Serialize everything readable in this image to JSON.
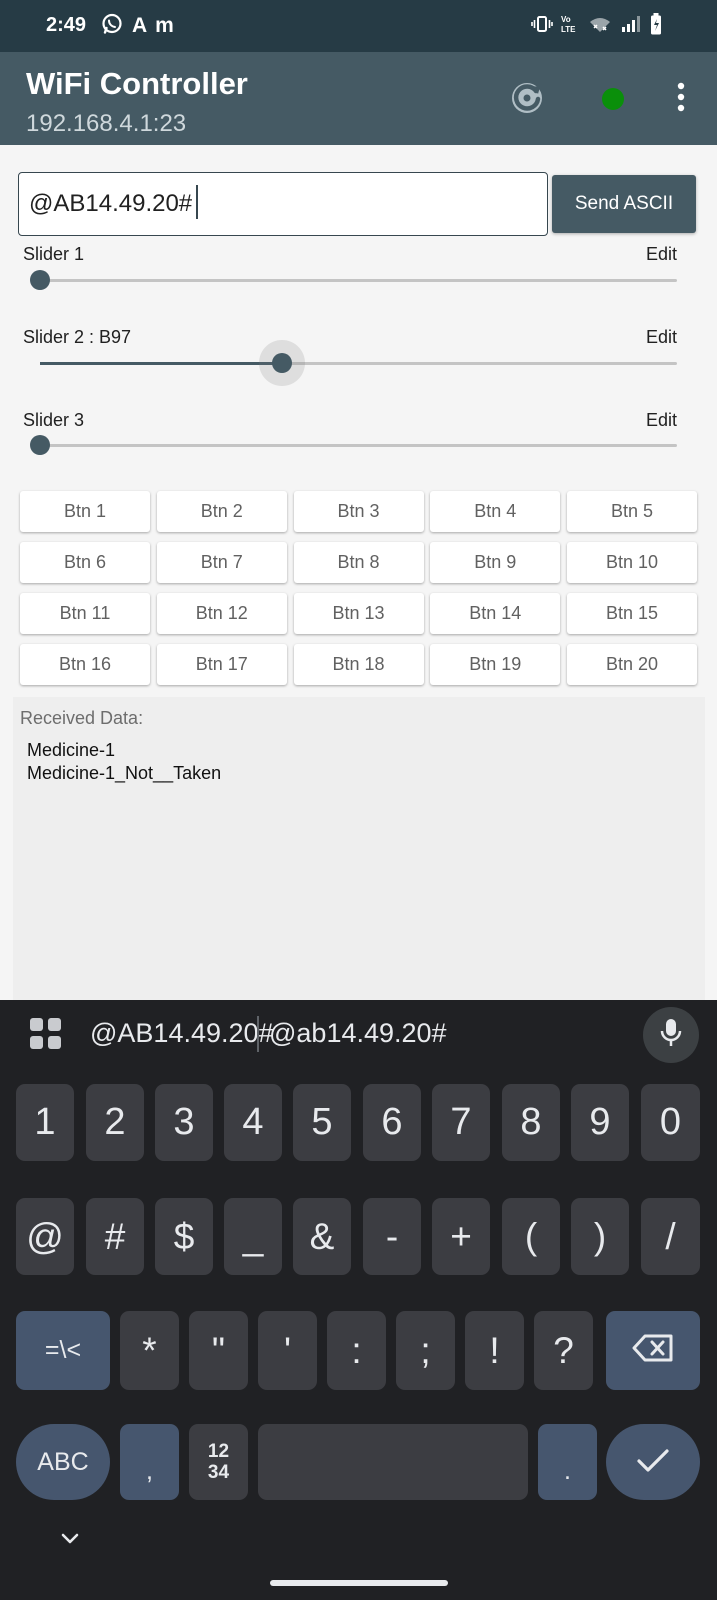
{
  "status_bar": {
    "time": "2:49",
    "left_icons": [
      "whatsapp-icon",
      "a-icon",
      "m-icon"
    ],
    "letter_a": "A",
    "letter_m": "m",
    "right_icons": [
      "vibrate-icon",
      "volte-icon",
      "wifi-data-icon",
      "signal-icon",
      "battery-icon"
    ],
    "volte_label": "VoLTE"
  },
  "app_bar": {
    "title": "WiFi Controller",
    "subtitle": "192.168.4.1:23",
    "actions": [
      "refresh-icon",
      "connection-status-dot",
      "more-vert-icon"
    ],
    "status_color": "#0a8f0a",
    "background": "#455a64"
  },
  "ascii_input": {
    "value": "@AB14.49.20#"
  },
  "send_button": {
    "label": "Send ASCII"
  },
  "sliders": [
    {
      "label": "Slider 1",
      "edit": "Edit",
      "value_fraction": 0.0
    },
    {
      "label": "Slider 2 : B97",
      "edit": "Edit",
      "value_fraction": 0.38
    },
    {
      "label": "Slider 3",
      "edit": "Edit",
      "value_fraction": 0.0
    }
  ],
  "buttons": [
    "Btn 1",
    "Btn 2",
    "Btn 3",
    "Btn 4",
    "Btn 5",
    "Btn 6",
    "Btn 7",
    "Btn 8",
    "Btn 9",
    "Btn 10",
    "Btn 11",
    "Btn 12",
    "Btn 13",
    "Btn 14",
    "Btn 15",
    "Btn 16",
    "Btn 17",
    "Btn 18",
    "Btn 19",
    "Btn 20"
  ],
  "received": {
    "label": "Received Data:",
    "lines": [
      "Medicine-1",
      "Medicine-1_Not__Taken"
    ]
  },
  "keyboard": {
    "suggestions": [
      "@AB14.49.20#",
      "@ab14.49.20#"
    ],
    "row1": [
      "1",
      "2",
      "3",
      "4",
      "5",
      "6",
      "7",
      "8",
      "9",
      "0"
    ],
    "row2": [
      "@",
      "#",
      "$",
      "_",
      "&",
      "-",
      "+",
      "(",
      ")",
      "/"
    ],
    "row3": [
      "=\\<",
      "*",
      "\"",
      "'",
      ":",
      ";",
      "!",
      "?"
    ],
    "abc_label": "ABC",
    "comma": ",",
    "numpad_top": "12",
    "numpad_bottom": "34",
    "period": ".",
    "icons": [
      "apps-icon",
      "mic-icon",
      "backspace-icon",
      "enter-check-icon",
      "chevron-down-icon"
    ]
  }
}
